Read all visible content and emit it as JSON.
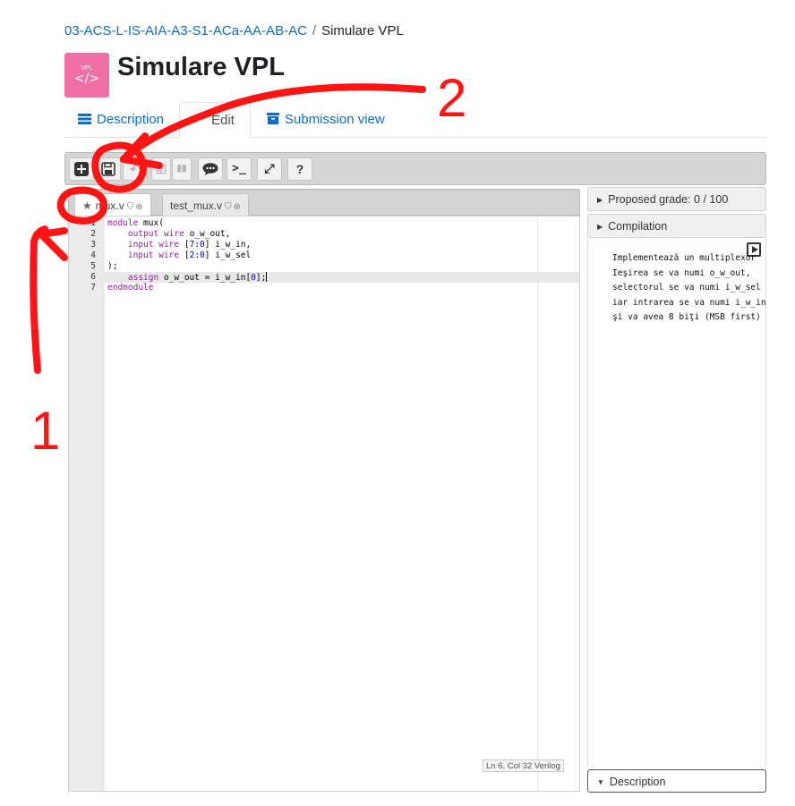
{
  "breadcrumb": {
    "course_link": "03-ACS-L-IS-AIA-A3-S1-ACa-AA-AB-AC",
    "separator": "/",
    "current": "Simulare VPL"
  },
  "header": {
    "icon_text": "VPL",
    "icon_symbol": "</>",
    "title": "Simulare VPL"
  },
  "tabs": {
    "description": "Description",
    "edit": "Edit",
    "submission": "Submission view"
  },
  "toolbar": {
    "new": "+",
    "save": "💾",
    "undo": "↶",
    "evaluate": "☑",
    "run": "▮▮",
    "comments": "💬",
    "console": ">_",
    "fullscreen": "⤢",
    "help": "?"
  },
  "editor_tabs": [
    {
      "name": "mux.v",
      "starred": true
    },
    {
      "name": "test_mux.v",
      "starred": false
    }
  ],
  "code_lines": [
    [
      {
        "t": "module",
        "c": "kw"
      },
      {
        "t": " mux("
      }
    ],
    [
      {
        "t": "    "
      },
      {
        "t": "output",
        "c": "kw"
      },
      {
        "t": " "
      },
      {
        "t": "wire",
        "c": "kw"
      },
      {
        "t": " o_w_out,"
      }
    ],
    [
      {
        "t": "    "
      },
      {
        "t": "input",
        "c": "kw"
      },
      {
        "t": " "
      },
      {
        "t": "wire",
        "c": "kw"
      },
      {
        "t": " ["
      },
      {
        "t": "7",
        "c": "num"
      },
      {
        "t": ":"
      },
      {
        "t": "0",
        "c": "num"
      },
      {
        "t": "] i_w_in,"
      }
    ],
    [
      {
        "t": "    "
      },
      {
        "t": "input",
        "c": "kw"
      },
      {
        "t": " "
      },
      {
        "t": "wire",
        "c": "kw"
      },
      {
        "t": " ["
      },
      {
        "t": "2",
        "c": "num"
      },
      {
        "t": ":"
      },
      {
        "t": "0",
        "c": "num"
      },
      {
        "t": "] i_w_sel"
      }
    ],
    [
      {
        "t": ");"
      }
    ],
    [
      {
        "t": "    "
      },
      {
        "t": "assign",
        "c": "kw"
      },
      {
        "t": " o_w_out = i_w_in["
      },
      {
        "t": "0",
        "c": "num"
      },
      {
        "t": "];"
      },
      {
        "cursor": true
      }
    ],
    [
      {
        "t": "endmodule",
        "c": "kw"
      }
    ]
  ],
  "line_numbers": [
    "1",
    "2",
    "3",
    "4",
    "5",
    "6",
    "7"
  ],
  "status_bar": "Ln 6, Col 32 Verilog",
  "side_panel": {
    "grade": "Proposed grade: 0 / 100",
    "compilation": "Compilation",
    "description": "Description",
    "console_lines": [
      "Implementează un multiplexor",
      "Ieşirea se va numi o_w_out,",
      "selectorul se va numi i_w_sel",
      "iar intrarea se va numi i_w_in",
      "şi va avea 8 biţi (MSB first)"
    ]
  },
  "annotations": {
    "label_1": "1",
    "label_2": "2",
    "color": "#ff1414"
  }
}
